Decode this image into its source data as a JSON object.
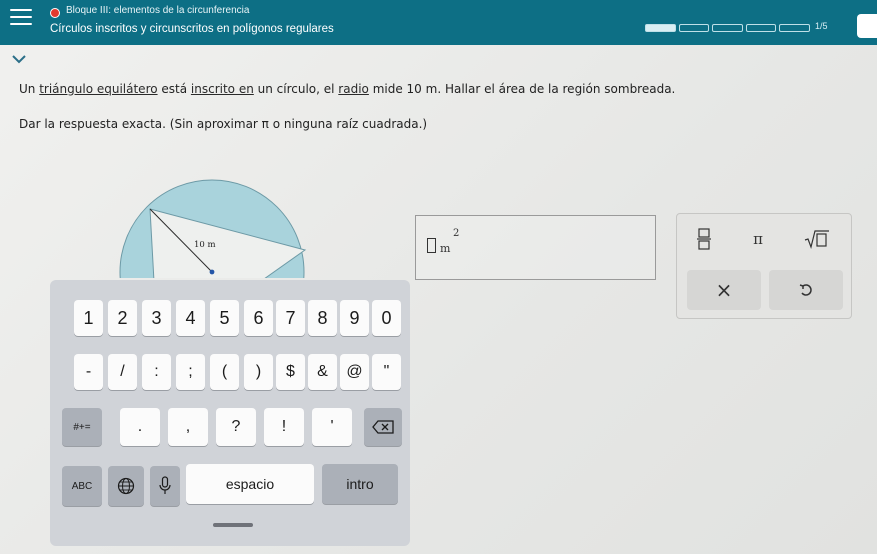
{
  "header": {
    "title": "Bloque III: elementos de la circunferencia",
    "subtitle": "Círculos inscritos y circunscritos en polígonos regulares",
    "progress_text": "1/5",
    "progress": 0.2
  },
  "question": {
    "part1": "Un ",
    "link1": "triángulo equilátero",
    "part2": " está ",
    "link2": "inscrito en",
    "part3": " un círculo, el ",
    "link3": "radio",
    "part4": " mide 10 m. Hallar el área de la región sombreada.",
    "instruction": "Dar la respuesta exacta. (Sin aproximar π o ninguna raíz cuadrada.)"
  },
  "figure": {
    "radius_label": "10 m",
    "circle_fill": "#a9d3dc",
    "triangle_fill": "#eef0ee"
  },
  "answer": {
    "unit": "m",
    "exponent": "2"
  },
  "math_toolbar": {
    "fraction_icon": "fraction-icon",
    "pi_label": "π",
    "sqrt_icon": "sqrt-icon",
    "clear_label": "×",
    "undo_icon": "undo-icon"
  },
  "keyboard": {
    "row1": [
      "1",
      "2",
      "3",
      "4",
      "5",
      "6",
      "7",
      "8",
      "9",
      "0"
    ],
    "row2": [
      "-",
      "/",
      ":",
      ";",
      "(",
      ")",
      "$",
      "&",
      "@",
      "\""
    ],
    "row3": {
      "toggle": "#+=",
      "keys": [
        ".",
        ",",
        "?",
        "!",
        "'"
      ],
      "backspace_icon": "backspace-icon"
    },
    "row4": {
      "abc": "ABC",
      "globe_icon": "globe-icon",
      "mic_icon": "microphone-icon",
      "space": "espacio",
      "enter": "intro"
    }
  },
  "colors": {
    "header_bg": "#0d6f85",
    "accent": "#0d6f85",
    "status_dot": "#e23a2e"
  }
}
